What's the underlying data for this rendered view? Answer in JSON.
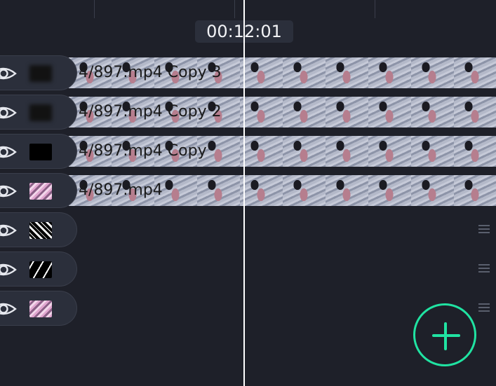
{
  "timecode": "00:12:01",
  "accent_color": "#20e3a2",
  "tracks": [
    {
      "name": "track-1",
      "thumb": "blurred-dark",
      "has_clip": true,
      "clip_label": "4/897.mp4  Copy  3"
    },
    {
      "name": "track-2",
      "thumb": "blurred-dark",
      "has_clip": true,
      "clip_label": "4/897.mp4  Copy  2"
    },
    {
      "name": "track-3",
      "thumb": "black",
      "has_clip": true,
      "clip_label": "4/897.mp4  Copy"
    },
    {
      "name": "track-4",
      "thumb": "image",
      "has_clip": true,
      "clip_label": "4/897.mp4"
    },
    {
      "name": "track-5",
      "thumb": "mask",
      "has_clip": false
    },
    {
      "name": "track-6",
      "thumb": "mask",
      "has_clip": false
    },
    {
      "name": "track-7",
      "thumb": "image",
      "has_clip": false
    }
  ],
  "icons": {
    "visibility": "eye-icon",
    "reorder": "drag-handle-icon",
    "add": "plus-icon"
  }
}
